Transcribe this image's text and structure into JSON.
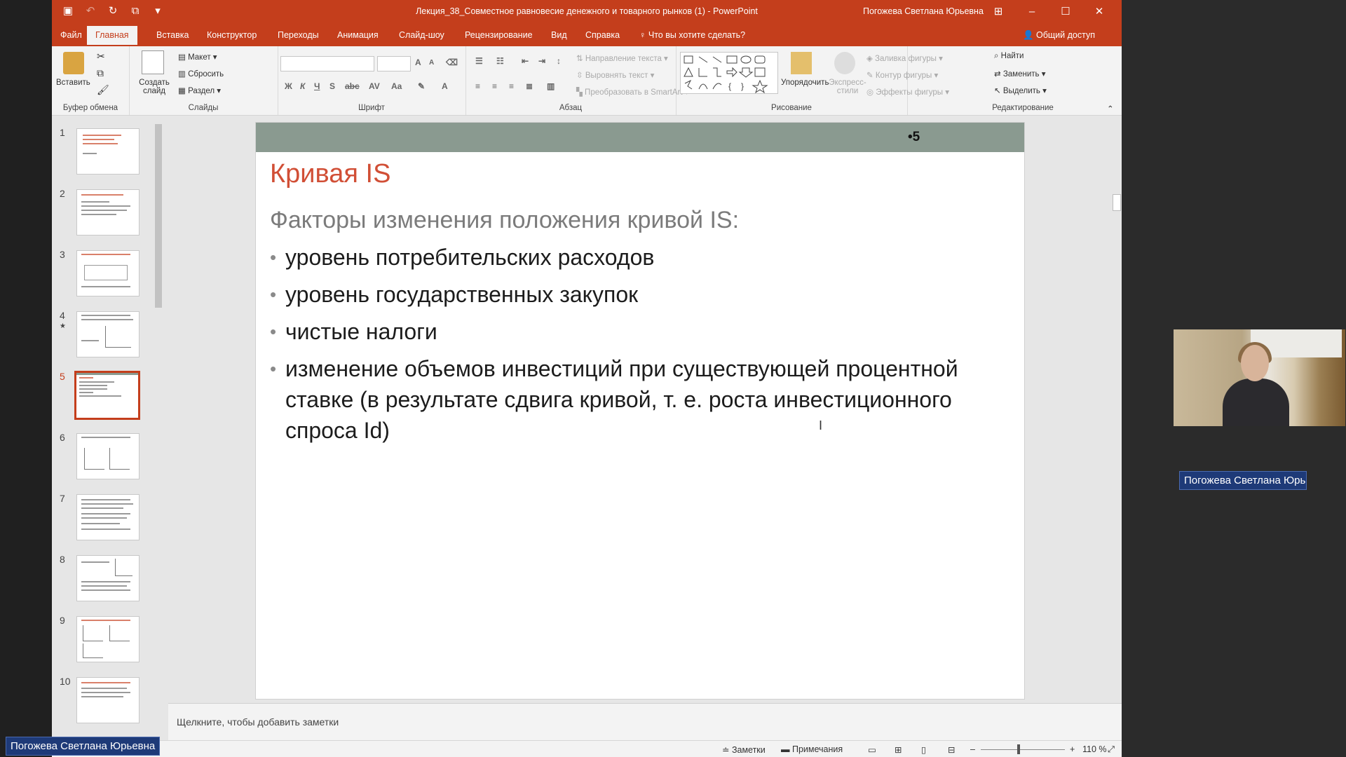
{
  "window": {
    "doc_title": "Лекция_38_Совместное равновесие денежного и товарного рынков (1)  -  PowerPoint",
    "user": "Погожева Светлана Юрьевна"
  },
  "tabs": [
    "Файл",
    "Главная",
    "Вставка",
    "Конструктор",
    "Переходы",
    "Анимация",
    "Слайд-шоу",
    "Рецензирование",
    "Вид",
    "Справка"
  ],
  "tell_me": "Что вы хотите сделать?",
  "share": "Общий доступ",
  "ribbon": {
    "clipboard": {
      "paste": "Вставить",
      "label": "Буфер обмена"
    },
    "slides": {
      "new_slide": "Создать слайд",
      "layout": "Макет",
      "reset": "Сбросить",
      "section": "Раздел",
      "label": "Слайды"
    },
    "font": {
      "label": "Шрифт"
    },
    "paragraph": {
      "text_direction": "Направление текста",
      "align_text": "Выровнять текст",
      "smartart": "Преобразовать в SmartArt",
      "label": "Абзац"
    },
    "drawing": {
      "arrange": "Упорядочить",
      "quick_styles": "Экспресс-стили",
      "fill": "Заливка фигуры",
      "outline": "Контур фигуры",
      "effects": "Эффекты фигуры",
      "label": "Рисование"
    },
    "editing": {
      "find": "Найти",
      "replace": "Заменить",
      "select": "Выделить",
      "label": "Редактирование"
    }
  },
  "thumbnails": [
    "1",
    "2",
    "3",
    "4",
    "5",
    "6",
    "7",
    "8",
    "9",
    "10"
  ],
  "active_slide": 5,
  "slide": {
    "number": "•5",
    "title": "Кривая IS",
    "subtitle": "Факторы изменения положения кривой IS:",
    "bullets": [
      "уровень потребительских расходов",
      "уровень государственных закупок",
      "чистые налоги",
      "изменение объемов инвестиций при существующей процентной ставке (в результате сдвига кривой, т. е. роста инвестиционного спроса Id)"
    ]
  },
  "notes_placeholder": "Щелкните, чтобы добавить заметки",
  "status": {
    "notes": "Заметки",
    "comments": "Примечания",
    "zoom": "110 %"
  },
  "overlay": {
    "name_left": "Погожева Светлана Юрьевна",
    "name_right": "Погожева Светлана Юрь..."
  },
  "colors": {
    "accent": "#c43e1c",
    "title_red": "#d14f36"
  }
}
